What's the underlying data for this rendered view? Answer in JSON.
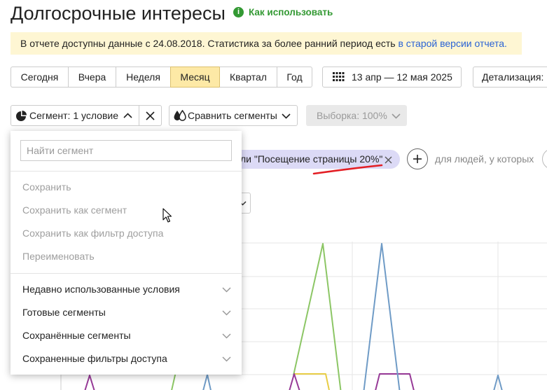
{
  "header": {
    "title": "Долгосрочные интересы",
    "help_link": "Как использовать"
  },
  "notice": {
    "text": "В отчете доступны данные с 24.08.2018. Статистика за более ранний период есть ",
    "link": "в старой версии отчета."
  },
  "period": {
    "buttons": [
      "Сегодня",
      "Вчера",
      "Неделя",
      "Месяц",
      "Квартал",
      "Год"
    ],
    "active_index": 3
  },
  "date_range": {
    "label": "13 апр — 12 мая 2025"
  },
  "detail": {
    "label": "Детализация:"
  },
  "segment_bar": {
    "segment_label": "Сегмент: 1 условие",
    "compare_label": "Сравнить сегменты",
    "sample_label": "Выборка: 100%"
  },
  "segment_menu": {
    "search_placeholder": "Найти сегмент",
    "actions": [
      "Сохранить",
      "Сохранить как сегмент",
      "Сохранить как фильтр доступа",
      "Переименовать"
    ],
    "sections": [
      "Недавно использованные условия",
      "Готовые сегменты",
      "Сохранённые сегменты",
      "Сохраненные фильтры доступа"
    ]
  },
  "conditions": {
    "chip_label": "ли \"Посещение страницы 20%\"",
    "suffix": "для людей, у которых"
  },
  "colors": {
    "accent_active": "#fde9a6",
    "help_green": "#339933",
    "link_blue": "#2a63d4",
    "notice_bg": "#fef6d3",
    "chip_bg": "#dcdaf6",
    "annotation_red": "#e31e24",
    "series_green": "#8cc665",
    "series_blue": "#6f9bc6",
    "series_yellow": "#e8cd45",
    "series_purple": "#973a97"
  },
  "icons": {
    "info": "info-icon",
    "calendar": "calendar-icon",
    "segment": "pie-chart-icon",
    "compare": "compare-segments-icon",
    "close": "close-icon",
    "expand": "chevron-down-icon",
    "collapse": "chevron-up-icon",
    "add": "plus-icon"
  }
}
